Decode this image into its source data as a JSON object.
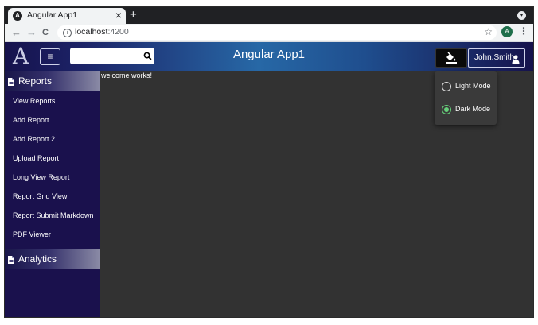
{
  "browser": {
    "tab": {
      "title": "Angular App1",
      "favicon": "A",
      "close": "×"
    },
    "new_tab": "+",
    "tab_menu": "▾",
    "nav": {
      "back": "←",
      "forward": "→",
      "reload": "C"
    },
    "address": {
      "host": "localhost",
      "port": ":4200",
      "info": "i"
    },
    "bookmark": "☆",
    "profile_initial": "A",
    "menu": "⋮"
  },
  "header": {
    "logo": "A",
    "menu_toggle": "≡",
    "search": {
      "placeholder": "",
      "value": ""
    },
    "title": "Angular App1",
    "user_name": "John.Smith"
  },
  "sidebar": {
    "sections": [
      {
        "label": "Reports",
        "icon": "document-icon"
      },
      {
        "label": "Analytics",
        "icon": "document-icon"
      }
    ],
    "report_items": [
      "View Reports",
      "Add Report",
      "Add Report 2",
      "Upload Report",
      "Long View Report",
      "Report Grid View",
      "Report Submit Markdown",
      "PDF Viewer"
    ]
  },
  "content": {
    "message": "welcome works!"
  },
  "theme_menu": {
    "options": [
      {
        "label": "Light Mode",
        "checked": false
      },
      {
        "label": "Dark Mode",
        "checked": true
      }
    ]
  },
  "colors": {
    "sidebar": "#1a114d",
    "content": "#323232",
    "accent_green": "#66d17b",
    "header_mid": "#2768a6"
  }
}
